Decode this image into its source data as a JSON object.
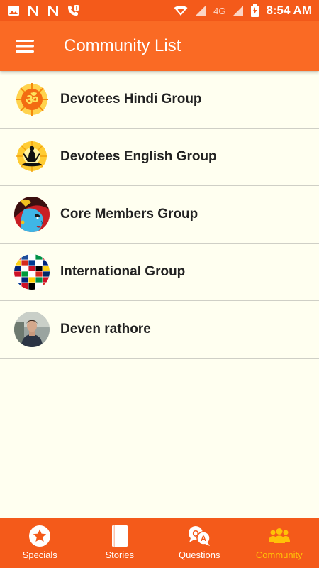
{
  "status_bar": {
    "network": "4G",
    "time": "8:54 AM"
  },
  "app_bar": {
    "title": "Community List"
  },
  "communities": [
    {
      "name": "Devotees Hindi Group",
      "avatar_icon": "om-symbol-icon"
    },
    {
      "name": "Devotees English Group",
      "avatar_icon": "meditation-silhouette-icon"
    },
    {
      "name": "Core Members Group",
      "avatar_icon": "krishna-portrait-icon"
    },
    {
      "name": "International Group",
      "avatar_icon": "world-flags-icon"
    },
    {
      "name": "Deven rathore",
      "avatar_icon": "user-photo-icon"
    }
  ],
  "bottom_nav": {
    "items": [
      {
        "label": "Specials",
        "icon": "star-badge-icon"
      },
      {
        "label": "Stories",
        "icon": "book-icon"
      },
      {
        "label": "Questions",
        "icon": "qa-bubbles-icon"
      },
      {
        "label": "Community",
        "icon": "people-group-icon",
        "active": true
      }
    ]
  },
  "colors": {
    "status_bar": "#f45a1a",
    "app_bar": "#fa6a24",
    "background": "#fffff0",
    "active_tab": "#ffc107"
  }
}
